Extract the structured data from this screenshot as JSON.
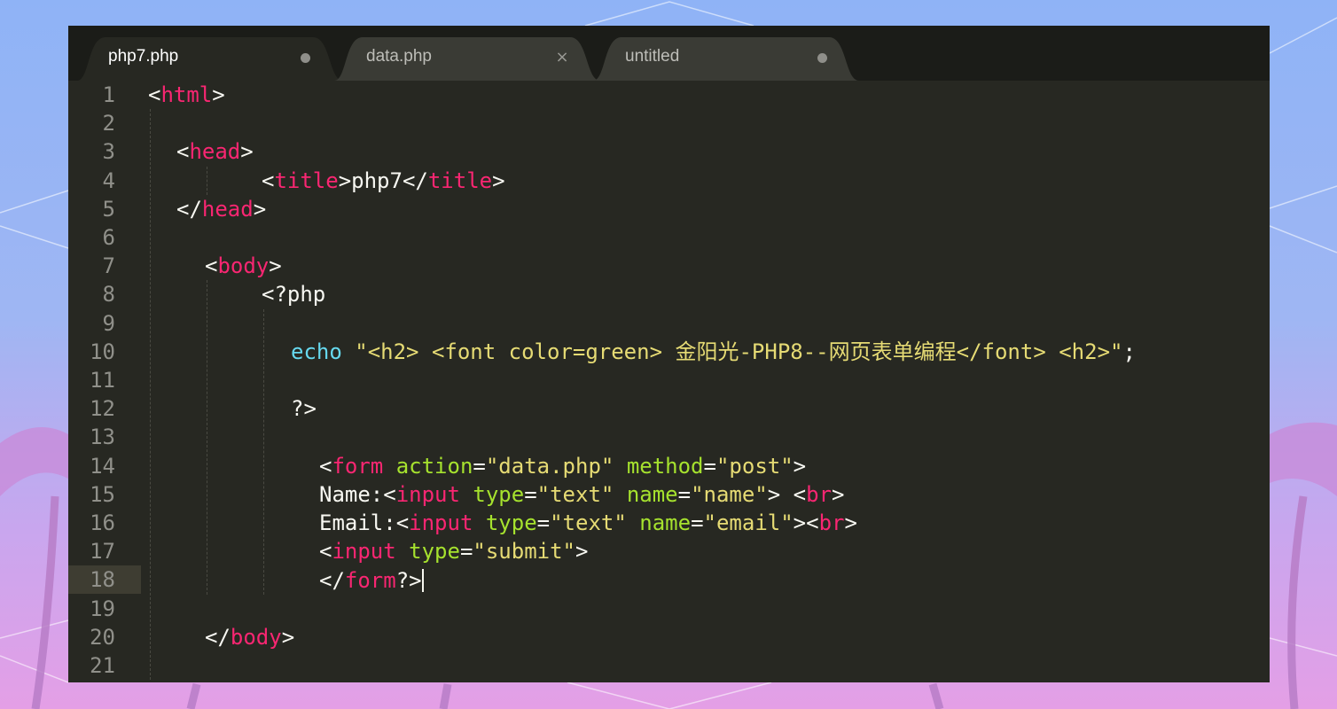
{
  "window": {
    "tabs": [
      {
        "label": "php7.php",
        "indicator": "dot",
        "active": true
      },
      {
        "label": "data.php",
        "indicator": "close",
        "active": false
      },
      {
        "label": "untitled",
        "indicator": "dot",
        "active": false
      }
    ],
    "close_glyph": "×"
  },
  "editor": {
    "current_line": 18,
    "line_numbers": [
      "1",
      "2",
      "3",
      "4",
      "5",
      "6",
      "7",
      "8",
      "9",
      "10",
      "11",
      "12",
      "13",
      "14",
      "15",
      "16",
      "17",
      "18",
      "19",
      "20",
      "21"
    ],
    "lines": [
      [
        {
          "c": "p",
          "t": "<"
        },
        {
          "c": "t",
          "t": "html"
        },
        {
          "c": "p",
          "t": ">"
        }
      ],
      [],
      [
        {
          "c": "p",
          "t": "<"
        },
        {
          "c": "t",
          "t": "head"
        },
        {
          "c": "p",
          "t": ">"
        }
      ],
      [
        {
          "c": "p",
          "t": "<"
        },
        {
          "c": "t",
          "t": "title"
        },
        {
          "c": "p",
          "t": ">php7</"
        },
        {
          "c": "t",
          "t": "title"
        },
        {
          "c": "p",
          "t": ">"
        }
      ],
      [
        {
          "c": "p",
          "t": "</"
        },
        {
          "c": "t",
          "t": "head"
        },
        {
          "c": "p",
          "t": ">"
        }
      ],
      [],
      [
        {
          "c": "p",
          "t": "<"
        },
        {
          "c": "t",
          "t": "body"
        },
        {
          "c": "p",
          "t": ">"
        }
      ],
      [
        {
          "c": "p",
          "t": "<?php"
        }
      ],
      [],
      [
        {
          "c": "k",
          "t": "echo"
        },
        {
          "c": "p",
          "t": " "
        },
        {
          "c": "s",
          "t": "\"<h2> <font color=green> 金阳光-PHP8--网页表单编程</font> <h2>\""
        },
        {
          "c": "p",
          "t": ";"
        }
      ],
      [],
      [
        {
          "c": "p",
          "t": "?>"
        }
      ],
      [],
      [
        {
          "c": "p",
          "t": "<"
        },
        {
          "c": "t",
          "t": "form"
        },
        {
          "c": "p",
          "t": " "
        },
        {
          "c": "a",
          "t": "action"
        },
        {
          "c": "p",
          "t": "="
        },
        {
          "c": "s",
          "t": "\"data.php\""
        },
        {
          "c": "p",
          "t": " "
        },
        {
          "c": "a",
          "t": "method"
        },
        {
          "c": "p",
          "t": "="
        },
        {
          "c": "s",
          "t": "\"post\""
        },
        {
          "c": "p",
          "t": ">"
        }
      ],
      [
        {
          "c": "p",
          "t": "Name:<"
        },
        {
          "c": "t",
          "t": "input"
        },
        {
          "c": "p",
          "t": " "
        },
        {
          "c": "a",
          "t": "type"
        },
        {
          "c": "p",
          "t": "="
        },
        {
          "c": "s",
          "t": "\"text\""
        },
        {
          "c": "p",
          "t": " "
        },
        {
          "c": "a",
          "t": "name"
        },
        {
          "c": "p",
          "t": "="
        },
        {
          "c": "s",
          "t": "\"name\""
        },
        {
          "c": "p",
          "t": "> <"
        },
        {
          "c": "t",
          "t": "br"
        },
        {
          "c": "p",
          "t": ">"
        }
      ],
      [
        {
          "c": "p",
          "t": "Email:<"
        },
        {
          "c": "t",
          "t": "input"
        },
        {
          "c": "p",
          "t": " "
        },
        {
          "c": "a",
          "t": "type"
        },
        {
          "c": "p",
          "t": "="
        },
        {
          "c": "s",
          "t": "\"text\""
        },
        {
          "c": "p",
          "t": " "
        },
        {
          "c": "a",
          "t": "name"
        },
        {
          "c": "p",
          "t": "="
        },
        {
          "c": "s",
          "t": "\"email\""
        },
        {
          "c": "p",
          "t": "><"
        },
        {
          "c": "t",
          "t": "br"
        },
        {
          "c": "p",
          "t": ">"
        }
      ],
      [
        {
          "c": "p",
          "t": "<"
        },
        {
          "c": "t",
          "t": "input"
        },
        {
          "c": "p",
          "t": " "
        },
        {
          "c": "a",
          "t": "type"
        },
        {
          "c": "p",
          "t": "="
        },
        {
          "c": "s",
          "t": "\"submit\""
        },
        {
          "c": "p",
          "t": ">"
        }
      ],
      [
        {
          "c": "p",
          "t": "</"
        },
        {
          "c": "t",
          "t": "form"
        },
        {
          "c": "p",
          "t": "?>"
        }
      ],
      [],
      [
        {
          "c": "p",
          "t": "</"
        },
        {
          "c": "t",
          "t": "body"
        },
        {
          "c": "p",
          "t": ">"
        }
      ],
      []
    ]
  },
  "colors": {
    "editor_bg": "#272822",
    "tabbar_bg": "#1b1c18",
    "tag": "#f92672",
    "attribute": "#a6e22e",
    "string": "#e6db74",
    "keyword": "#66d9ef",
    "plain": "#f8f8f2",
    "line_number": "#90908a"
  }
}
